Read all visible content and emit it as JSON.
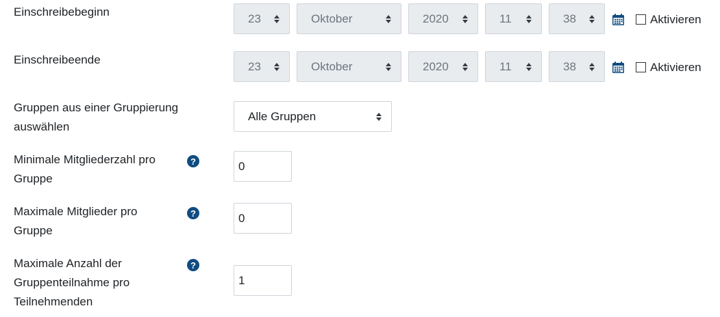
{
  "start": {
    "label": "Einschreibebeginn",
    "day": "23",
    "month": "Oktober",
    "year": "2020",
    "hour": "11",
    "minute": "38",
    "checkbox_label": "Aktivieren"
  },
  "end": {
    "label": "Einschreibeende",
    "day": "23",
    "month": "Oktober",
    "year": "2020",
    "hour": "11",
    "minute": "38",
    "checkbox_label": "Aktivieren"
  },
  "grouping": {
    "label_line1": "Gruppen aus einer Gruppierung",
    "label_line2": "auswählen",
    "value": "Alle Gruppen"
  },
  "min_members": {
    "label_line1": "Minimale Mitgliederzahl pro",
    "label_line2": "Gruppe",
    "value": "0"
  },
  "max_members": {
    "label_line1": "Maximale Mitglieder pro",
    "label_line2": "Gruppe",
    "value": "0"
  },
  "max_participation": {
    "label_line1": "Maximale Anzahl der",
    "label_line2": "Gruppenteilnahme pro",
    "label_line3": "Teilnehmenden",
    "value": "1"
  },
  "icons": {
    "help": "question-circle-icon",
    "calendar": "calendar-icon"
  },
  "colors": {
    "help_icon": "#0f4c81",
    "disabled_select_bg": "#e9ecef"
  }
}
